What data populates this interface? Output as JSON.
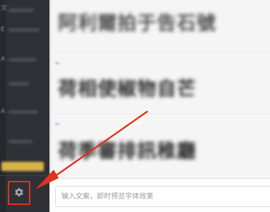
{
  "app": {
    "accent_color": "#e0321c",
    "sidebar_color": "#2f3136"
  },
  "sidebar": {
    "glyphs": [
      "文",
      "E",
      "A",
      "A"
    ],
    "settings_icon": "gear-icon"
  },
  "preview": {
    "rows": [
      {
        "text": "阿利爾拍于告石號"
      },
      {
        "text": "荷相使椒物自芒"
      },
      {
        "text": "荷季審排訊稚廳"
      }
    ]
  },
  "input": {
    "value": "",
    "placeholder": "输入文案，即时预览字体效果"
  },
  "annotation": {
    "highlight_target": "settings-button",
    "color": "#e0321c"
  }
}
